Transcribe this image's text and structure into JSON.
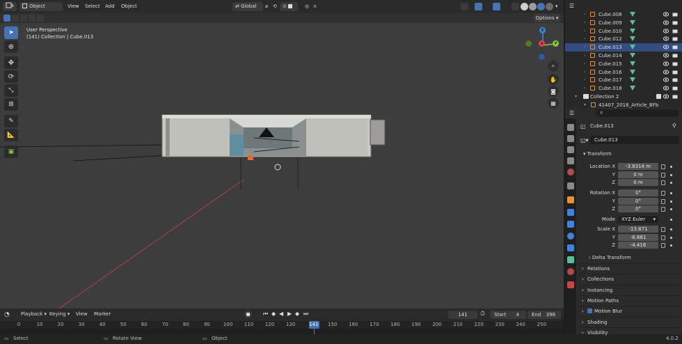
{
  "viewport_header": {
    "mode": "Object Mode",
    "menus": [
      "View",
      "Select",
      "Add",
      "Object"
    ],
    "orientation": "Global",
    "options_label": "Options"
  },
  "viewport": {
    "perspective": "User Perspective",
    "collection_info": "(141) Collection | Cube.013",
    "gizmo": {
      "x": "X",
      "y": "Y",
      "z": "Z"
    }
  },
  "outliner": {
    "rows": [
      {
        "label": "Cube.008",
        "selected": false
      },
      {
        "label": "Cube.009",
        "selected": false
      },
      {
        "label": "Cube.010",
        "selected": false
      },
      {
        "label": "Cube.012",
        "selected": false
      },
      {
        "label": "Cube.013",
        "selected": true
      },
      {
        "label": "Cube.014",
        "selected": false
      },
      {
        "label": "Cube.015",
        "selected": false
      },
      {
        "label": "Cube.016",
        "selected": false
      },
      {
        "label": "Cube.017",
        "selected": false
      },
      {
        "label": "Cube.018",
        "selected": false
      }
    ],
    "collection2": "Collection 2",
    "article": "41407_2018_Article_BFb"
  },
  "properties": {
    "object_name": "Cube.013",
    "data_name": "Cube.013",
    "transform_label": "Transform",
    "location_label": "Location X",
    "location": [
      "-3.8314 m",
      "0 m",
      "0 m"
    ],
    "rotation_label": "Rotation X",
    "rotation": [
      "0°",
      "0°",
      "0°"
    ],
    "mode_label": "Mode",
    "mode_value": "XYZ Euler",
    "scale_label": "Scale X",
    "scale": [
      "-13.871",
      "-6.881",
      "-4.416"
    ],
    "axis_y": "Y",
    "axis_z": "Z",
    "delta_transform": "Delta Transform",
    "panels": [
      "Relations",
      "Collections",
      "Instancing",
      "Motion Paths",
      "Motion Blur",
      "Shading",
      "Visibility"
    ]
  },
  "timeline": {
    "menus": [
      "Playback",
      "Keying",
      "View",
      "Marker"
    ],
    "current_frame": "141",
    "start_label": "Start",
    "start": "4",
    "end_label": "End",
    "end": "398",
    "ticks": [
      "0",
      "10",
      "20",
      "30",
      "40",
      "50",
      "60",
      "70",
      "80",
      "90",
      "100",
      "110",
      "120",
      "130",
      "141",
      "150",
      "160",
      "170",
      "180",
      "190",
      "200",
      "210",
      "220",
      "230",
      "240",
      "250"
    ]
  },
  "status_bar": {
    "select": "Select",
    "rotate": "Rotate View",
    "object": "Object",
    "version": "4.0.2"
  },
  "colors": {
    "accent": "#4772b3",
    "x_axis": "#e8434f",
    "y_axis": "#8bc63e",
    "z_axis": "#3f83e0",
    "object_orange": "#e8923a",
    "mesh_green": "#5bc09a"
  }
}
